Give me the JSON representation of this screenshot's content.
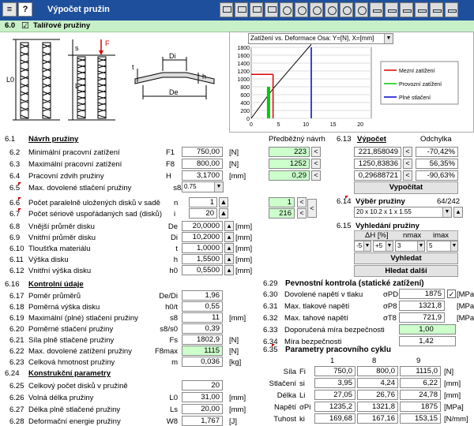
{
  "app": {
    "title": "Výpočet pružin",
    "help": "?"
  },
  "section": {
    "num": "6.0",
    "check": "☑",
    "title": "Talířové pružiny"
  },
  "chart_select": {
    "value": "Zatížení vs. Deformace   Osa: Y=[N], X=[mm]"
  },
  "chart_data": {
    "type": "line",
    "yticks": [
      "1800",
      "1600",
      "1400",
      "1200",
      "1000",
      "800",
      "600",
      "400",
      "200",
      "0"
    ],
    "xticks": [
      "0",
      "5",
      "10",
      "15",
      "20"
    ],
    "xlim": [
      0,
      22
    ],
    "ylim": [
      0,
      1800
    ],
    "curve": {
      "x": [
        0,
        4,
        11
      ],
      "y": [
        0,
        750,
        1875
      ]
    },
    "bar": {
      "x": 3.17,
      "y1": 750,
      "y2": 800
    },
    "series": [
      {
        "name": "Mezní zatížení",
        "color": "#dd0000"
      },
      {
        "name": "Provozní zatížení",
        "color": "#00cc00"
      },
      {
        "name": "Plné stlačení",
        "color": "#0000cc"
      }
    ],
    "limits": {
      "mezni_y": 1115,
      "mezni_x": 4,
      "plne_x": 11
    }
  },
  "drawing": {
    "F": "F",
    "s": "s",
    "L0": "L0",
    "L": "L",
    "Di": "Di",
    "De": "De",
    "t": "t",
    "h": "h"
  },
  "s61": {
    "num": "6.1",
    "title": "Návrh pružiny",
    "col_pred": "Předběžný návrh"
  },
  "rows_left": [
    {
      "num": "6.2",
      "label": "Minimální pracovní zatížení",
      "sym": "F1",
      "val": "750,00",
      "unit": "[N]",
      "pred": "223"
    },
    {
      "num": "6.3",
      "label": "Maximální pracovní zatížení",
      "sym": "F8",
      "val": "800,00",
      "unit": "[N]",
      "pred": "1252"
    },
    {
      "num": "6.4",
      "label": "Pracovní zdvih pružiny",
      "sym": "H",
      "val": "3,1700",
      "unit": "[mm]",
      "pred": "0,29"
    }
  ],
  "r65": {
    "num": "6.5",
    "label": "Max. dovolené stlačení pružiny",
    "sym": "s8/s0",
    "val": "0.75"
  },
  "r66": {
    "num": "6.6",
    "label": "Počet paralelně uložených disků v sadě",
    "sym": "n",
    "val": "1",
    "pred": "1"
  },
  "r67": {
    "num": "6.7",
    "label": "Počet sériově uspořádaných sad (disků)",
    "sym": "i",
    "val": "20",
    "pred": "216"
  },
  "rows_geom": [
    {
      "num": "6.8",
      "label": "Vnější průměr disku",
      "sym": "De",
      "val": "20,0000",
      "unit": "[mm]"
    },
    {
      "num": "6.9",
      "label": "Vnitřní průměr disku",
      "sym": "Di",
      "val": "10,2000",
      "unit": "[mm]"
    },
    {
      "num": "6.10",
      "label": "Tloušťka materiálu",
      "sym": "t",
      "val": "1,0000",
      "unit": "[mm]"
    },
    {
      "num": "6.11",
      "label": "Výška disku",
      "sym": "h",
      "val": "1,5500",
      "unit": "[mm]"
    },
    {
      "num": "6.12",
      "label": "Vnitřní výška disku",
      "sym": "h0",
      "val": "0,5500",
      "unit": "[mm]"
    }
  ],
  "s613": {
    "num": "6.13",
    "title": "Výpočet",
    "col_dev": "Odchylka",
    "rows": [
      {
        "val": "221,858049",
        "dev": "-70,42%"
      },
      {
        "val": "1250,83836",
        "dev": "56,35%"
      },
      {
        "val": "0,29688721",
        "dev": "-90,63%"
      }
    ],
    "button": "Vypočítat"
  },
  "s614": {
    "num": "6.14",
    "title": "Výběr pružiny",
    "count": "64/242",
    "select": "20 x 10.2 x 1 x 1.55"
  },
  "s615": {
    "num": "6.15",
    "title": "Vyhledání pružiny",
    "h1": "ΔH [%]",
    "h2": "nmax",
    "h3": "imax",
    "v1a": "-5",
    "v1b": "+5",
    "v2": "3",
    "v3": "5",
    "btn1": "Vyhledat",
    "btn2": "Hledat další"
  },
  "s616": {
    "num": "6.16",
    "title": "Kontrolní údaje"
  },
  "rows_ctrl": [
    {
      "num": "6.17",
      "label": "Poměr průměrů",
      "sym": "De/Di",
      "val": "1,96",
      "unit": ""
    },
    {
      "num": "6.18",
      "label": "Poměrná výška disku",
      "sym": "h0/t",
      "val": "0,55",
      "unit": ""
    },
    {
      "num": "6.19",
      "label": "Maximální (plné) stlačení pružiny",
      "sym": "s8",
      "val": "11",
      "unit": "[mm]"
    },
    {
      "num": "6.20",
      "label": "Poměrné stlačení pružiny",
      "sym": "s8/s0",
      "val": "0,39",
      "unit": ""
    },
    {
      "num": "6.21",
      "label": "Síla plně stlačené pružiny",
      "sym": "Fs",
      "val": "1802,9",
      "unit": "[N]"
    },
    {
      "num": "6.22",
      "label": "Max. dovolené zatížení pružiny",
      "sym": "F8max",
      "val": "1115",
      "unit": "[N]"
    },
    {
      "num": "6.23",
      "label": "Celková hmotnost pružiny",
      "sym": "m",
      "val": "0,036",
      "unit": "[kg]"
    }
  ],
  "s624": {
    "num": "6.24",
    "title": "Konstrukční parametry"
  },
  "rows_constr": [
    {
      "num": "6.25",
      "label": "Celkový počet disků v pružině",
      "sym": "",
      "val": "20",
      "unit": ""
    },
    {
      "num": "6.26",
      "label": "Volná délka pružiny",
      "sym": "L0",
      "val": "31,00",
      "unit": "[mm]"
    },
    {
      "num": "6.27",
      "label": "Délka plně stlačené pružiny",
      "sym": "Ls",
      "val": "20,00",
      "unit": "[mm]"
    },
    {
      "num": "6.28",
      "label": "Deformační energie pružiny",
      "sym": "W8",
      "val": "1,767",
      "unit": "[J]"
    }
  ],
  "s629": {
    "num": "6.29",
    "title": "Pevnostní kontrola (statické zatížení)"
  },
  "rows_str": [
    {
      "num": "6.30",
      "label": "Dovolené napětí v tlaku",
      "sym": "σPD",
      "val": "1875",
      "unit": "[MPa]"
    },
    {
      "num": "6.31",
      "label": "Max. tlakové napětí",
      "sym": "σP8",
      "val": "1321,8",
      "unit": "[MPa]"
    },
    {
      "num": "6.32",
      "label": "Max. tahové napětí",
      "sym": "σT8",
      "val": "721,9",
      "unit": "[MPa]"
    },
    {
      "num": "6.33",
      "label": "Doporučená míra bezpečnosti",
      "sym": "",
      "val": "1,00",
      "unit": ""
    },
    {
      "num": "6.34",
      "label": "Míra bezpečnosti",
      "sym": "",
      "val": "1,42",
      "unit": ""
    }
  ],
  "s635": {
    "num": "6.35",
    "title": "Parametry pracovního cyklu",
    "cols": [
      "1",
      "8",
      "9"
    ],
    "rows": [
      {
        "label": "Síla",
        "sym": "Fi",
        "v": [
          "750,0",
          "800,0",
          "1115,0"
        ],
        "unit": "[N]"
      },
      {
        "label": "Stlačení",
        "sym": "si",
        "v": [
          "3,95",
          "4,24",
          "6,22"
        ],
        "unit": "[mm]"
      },
      {
        "label": "Délka",
        "sym": "Li",
        "v": [
          "27,05",
          "26,76",
          "24,78"
        ],
        "unit": "[mm]"
      },
      {
        "label": "Napětí",
        "sym": "σPi",
        "v": [
          "1235,2",
          "1321,8",
          "1875"
        ],
        "unit": "[MPa]"
      },
      {
        "label": "Tuhost",
        "sym": "ki",
        "v": [
          "169,68",
          "167,16",
          "153,15"
        ],
        "unit": "[N/mm]"
      }
    ]
  }
}
